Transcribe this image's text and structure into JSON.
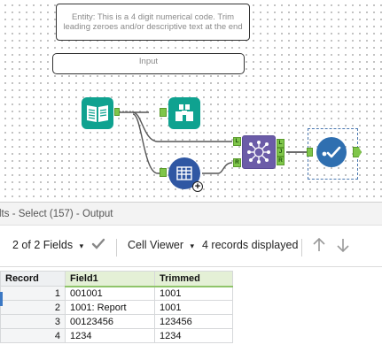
{
  "canvas": {
    "comment_entity": "Entity: This is a 4 digit numerical code. Trim leading zeroes and/or descriptive text at the end",
    "comment_input": "Input",
    "anchor_labels": {
      "left": "L",
      "join": "J",
      "right": "R"
    }
  },
  "results": {
    "title": "lts - Select (157) - Output",
    "fields_label": "2 of 2 Fields",
    "viewer_label": "Cell Viewer",
    "records_label": "4 records displayed"
  },
  "table": {
    "headers": [
      "Record",
      "Field1",
      "Trimmed"
    ],
    "rows": [
      {
        "record": "1",
        "field1": "001001",
        "trimmed": "1001"
      },
      {
        "record": "2",
        "field1": "1001: Report",
        "trimmed": "1001"
      },
      {
        "record": "3",
        "field1": "00123456",
        "trimmed": "123456"
      },
      {
        "record": "4",
        "field1": "1234",
        "trimmed": "1234"
      }
    ]
  },
  "colors": {
    "accent_green": "#7fc64a",
    "tool_teal": "#0fa290",
    "tool_purple": "#6b5ca8",
    "tool_blue": "#2f57a3",
    "selection_blue": "#3b78c4"
  },
  "icons": [
    "book-icon",
    "binoculars-icon",
    "formula-icon",
    "join-icon",
    "test-check-icon",
    "dropdown-arrow-icon",
    "check-icon",
    "up-arrow-icon",
    "down-arrow-icon"
  ]
}
